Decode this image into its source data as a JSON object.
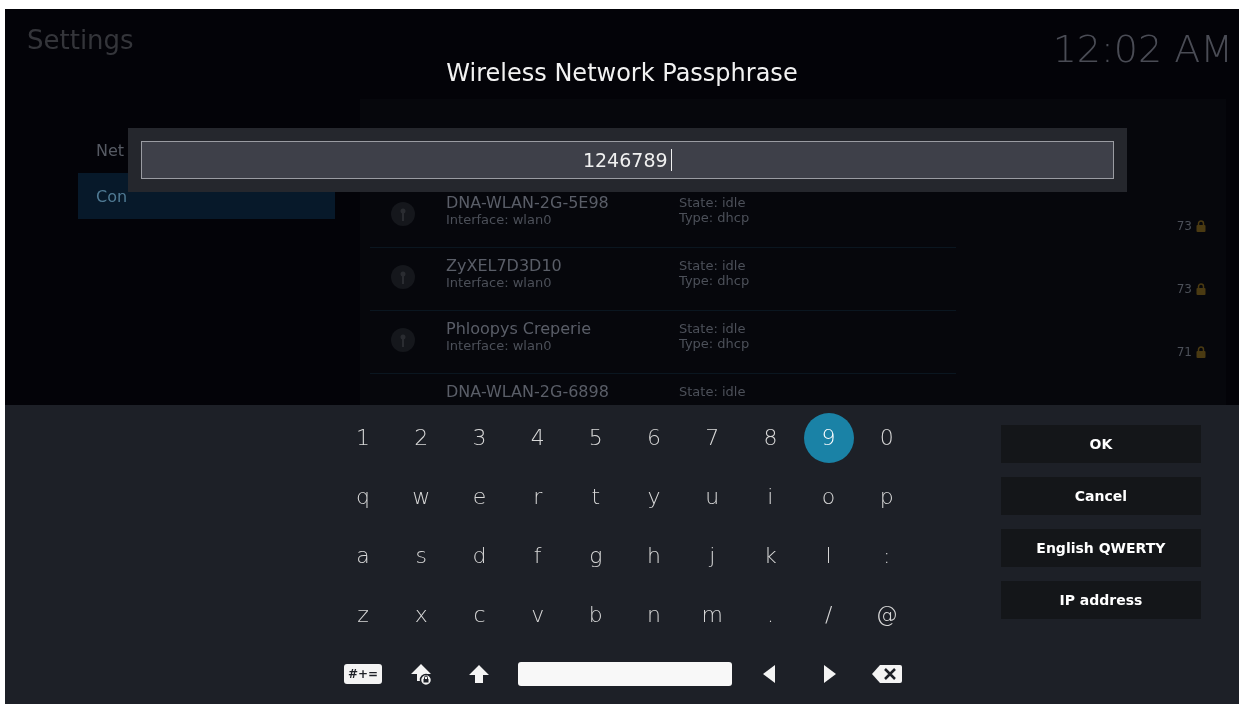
{
  "header": {
    "title": "Settings",
    "clock": "12:02 AM"
  },
  "sidebar": {
    "items": [
      {
        "label": "Net",
        "selected": false
      },
      {
        "label": "Con",
        "selected": true
      }
    ]
  },
  "networks": [
    {
      "name": "DNA-WLAN-2G-5E98",
      "interface": "Interface: wlan0",
      "state": "State: idle",
      "type": "Type: dhcp",
      "signal": "73",
      "locked": true
    },
    {
      "name": "ZyXEL7D3D10",
      "interface": "Interface: wlan0",
      "state": "State: idle",
      "type": "Type: dhcp",
      "signal": "73",
      "locked": true
    },
    {
      "name": "Phloopys Creperie",
      "interface": "Interface: wlan0",
      "state": "State: idle",
      "type": "Type: dhcp",
      "signal": "71",
      "locked": true
    },
    {
      "name": "DNA-WLAN-2G-6898",
      "state": "State: idle"
    }
  ],
  "dialog": {
    "title": "Wireless Network Passphrase",
    "value": "1246789"
  },
  "keyboard": {
    "rows": [
      [
        {
          "label": "1",
          "selected": false
        },
        {
          "label": "2",
          "selected": false
        },
        {
          "label": "3",
          "selected": false
        },
        {
          "label": "4",
          "selected": false
        },
        {
          "label": "5",
          "selected": false
        },
        {
          "label": "6",
          "selected": false
        },
        {
          "label": "7",
          "selected": false
        },
        {
          "label": "8",
          "selected": false
        },
        {
          "label": "9",
          "selected": true
        },
        {
          "label": "0",
          "selected": false
        }
      ],
      [
        {
          "label": "q",
          "selected": false
        },
        {
          "label": "w",
          "selected": false
        },
        {
          "label": "e",
          "selected": false
        },
        {
          "label": "r",
          "selected": false
        },
        {
          "label": "t",
          "selected": false
        },
        {
          "label": "y",
          "selected": false
        },
        {
          "label": "u",
          "selected": false
        },
        {
          "label": "i",
          "selected": false
        },
        {
          "label": "o",
          "selected": false
        },
        {
          "label": "p",
          "selected": false
        }
      ],
      [
        {
          "label": "a",
          "selected": false
        },
        {
          "label": "s",
          "selected": false
        },
        {
          "label": "d",
          "selected": false
        },
        {
          "label": "f",
          "selected": false
        },
        {
          "label": "g",
          "selected": false
        },
        {
          "label": "h",
          "selected": false
        },
        {
          "label": "j",
          "selected": false
        },
        {
          "label": "k",
          "selected": false
        },
        {
          "label": "l",
          "selected": false
        },
        {
          "label": ":",
          "selected": false
        }
      ],
      [
        {
          "label": "z",
          "selected": false
        },
        {
          "label": "x",
          "selected": false
        },
        {
          "label": "c",
          "selected": false
        },
        {
          "label": "v",
          "selected": false
        },
        {
          "label": "b",
          "selected": false
        },
        {
          "label": "n",
          "selected": false
        },
        {
          "label": "m",
          "selected": false
        },
        {
          "label": ".",
          "selected": false
        },
        {
          "label": "/",
          "selected": false
        },
        {
          "label": "@",
          "selected": false
        }
      ]
    ],
    "special_keys": [
      {
        "kind": "symbols",
        "label": "#+="
      },
      {
        "kind": "capslock"
      },
      {
        "kind": "shift"
      },
      {
        "kind": "space"
      },
      {
        "kind": "left"
      },
      {
        "kind": "right"
      },
      {
        "kind": "backspace"
      }
    ]
  },
  "buttons": [
    "OK",
    "Cancel",
    "English QWERTY",
    "IP address"
  ]
}
